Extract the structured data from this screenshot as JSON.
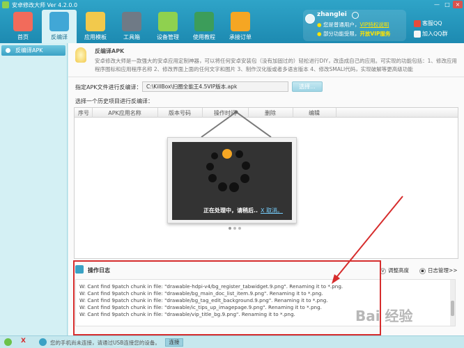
{
  "window": {
    "title": "安卓修改大师 Ver 4.2.0.0",
    "controls": [
      "—",
      "□",
      "×"
    ]
  },
  "tabs": [
    {
      "label": "首页",
      "color": "#f26b5b",
      "icon": "home-icon"
    },
    {
      "label": "反编译",
      "color": "#41a7d6",
      "icon": "decompile-icon"
    },
    {
      "label": "应用模板",
      "color": "#f2c94c",
      "icon": "template-icon"
    },
    {
      "label": "工具箱",
      "color": "#6f7a86",
      "icon": "toolbox-icon"
    },
    {
      "label": "设备管理",
      "color": "#8fd14f",
      "icon": "device-icon"
    },
    {
      "label": "使用教程",
      "color": "#3c9d5a",
      "icon": "tutorial-icon"
    },
    {
      "label": "承接订单",
      "color": "#f5a623",
      "icon": "order-icon"
    }
  ],
  "user": {
    "name": "zhanglei",
    "line1_text": "您是普通用户，",
    "line1_link": "VIP特权说明",
    "line2_text": "部分功能受限，",
    "line2_link": "开放VIP服务"
  },
  "qq": {
    "service": "客服QQ",
    "group": "加入QQ群"
  },
  "nav": {
    "item": "反编译APK"
  },
  "info": {
    "title": "反编译APK",
    "desc": "安卓修改大师是一款强大的安卓应用定制神器，可以将任何安卓安装包（没有加固过的）轻松进行DIY，改造成自己的应用。可实现的功能包括：1、修改应用程序图标和应用程序名称 2、修改界面上面的任何文字和图片 3、制作汉化版或者多语言版本 4、修改SMALI代码，实现破解等更高级功能"
  },
  "form": {
    "label": "指定APK文件进行反编译：",
    "path": "C:\\KillBox\\扫圈全能王4.5VIP版本.apk",
    "select_btn": "选择...",
    "history_label": "选择一个历史项目进行反编译："
  },
  "table": {
    "columns": [
      "序号",
      "APK应用名称",
      "版本号码",
      "操作时间",
      "删除",
      "编辑"
    ]
  },
  "overlay": {
    "processing": "正在处理中，请稍后..",
    "cancel": "X 取消。"
  },
  "log": {
    "title": "操作日志",
    "adjust": "调整高度",
    "manage": "日志管理>>",
    "lines": [
      "W: Cant find 9patch chunk in file: \"drawable-hdpi-v4/bg_register_tabwidget.9.png\". Renaming it to *.png.",
      "W: Cant find 9patch chunk in file: \"drawable/bg_main_doc_list_item.9.png\". Renaming it to *.png.",
      "W: Cant find 9patch chunk in file: \"drawable/bg_tag_edit_background.9.png\". Renaming it to *.png.",
      "W: Cant find 9patch chunk in file: \"drawable/ic_tips_up_imagepage.9.png\". Renaming it to *.png.",
      "W: Cant find 9patch chunk in file: \"drawable/vip_title_bg.9.png\". Renaming it to *.png."
    ]
  },
  "status": {
    "x": "X",
    "text": "您的手机尚未连接，请通过USB连接您的设备。",
    "connect": "连接"
  },
  "watermark": "Bai 经验"
}
